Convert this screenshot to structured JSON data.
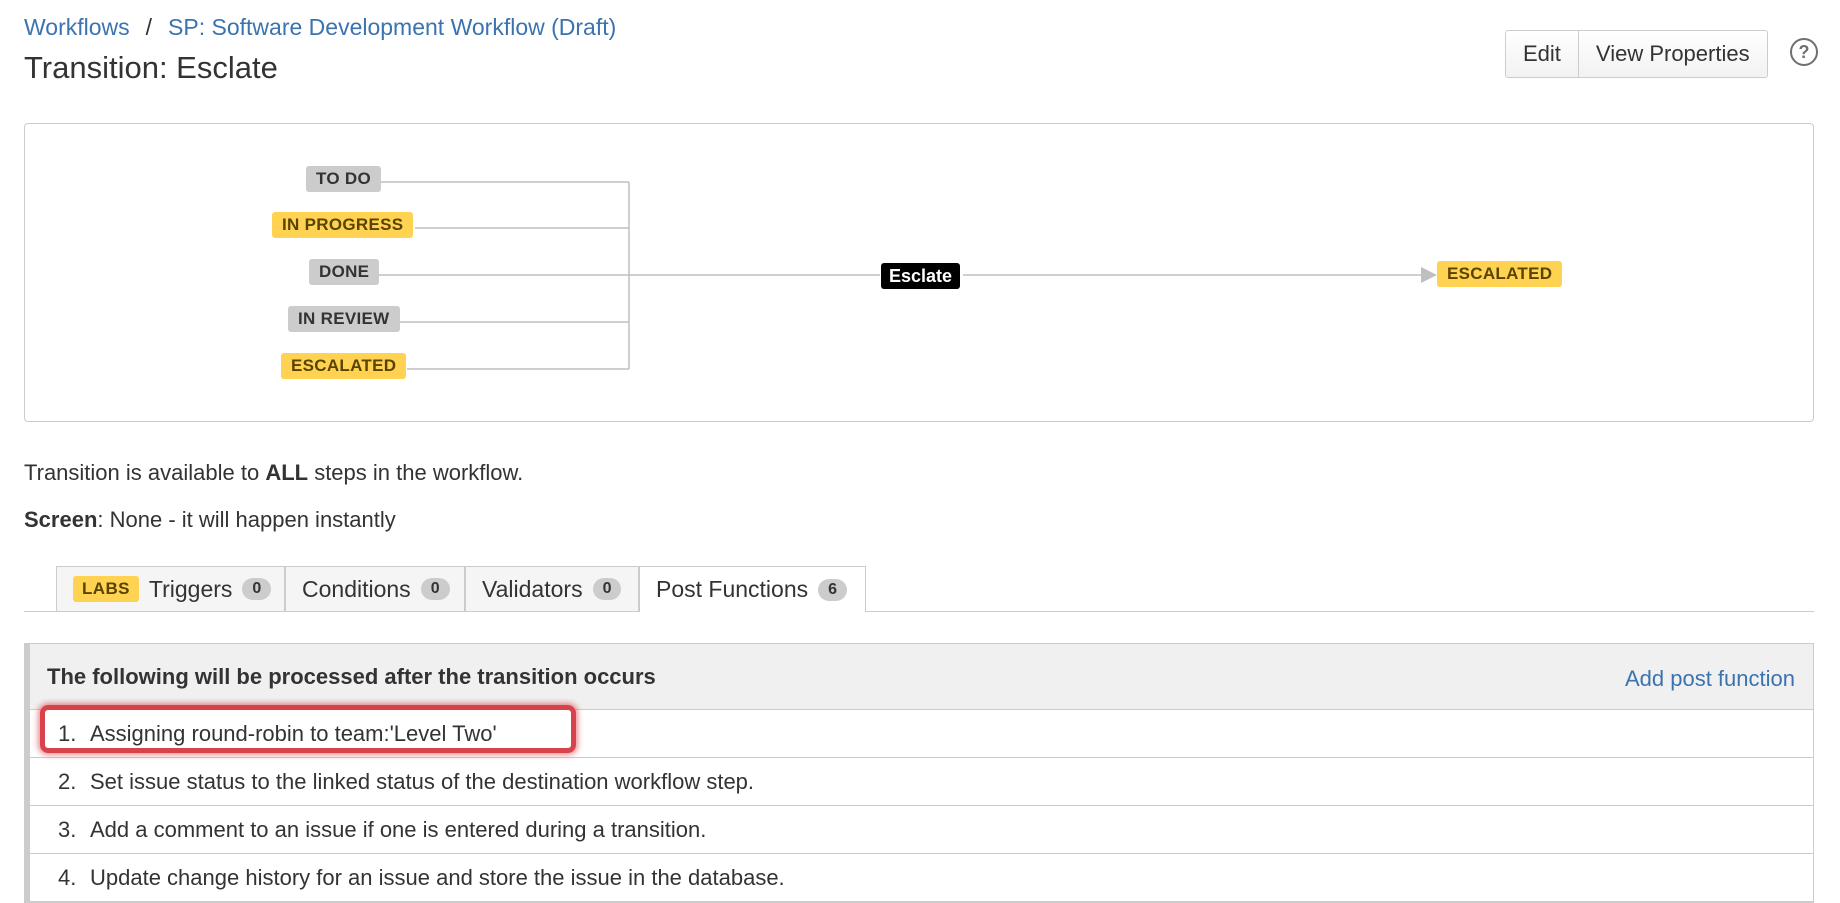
{
  "breadcrumb": {
    "workflows": "Workflows",
    "separator": "/",
    "workflow_name": "SP: Software Development Workflow (Draft)"
  },
  "page_title": "Transition: Esclate",
  "actions": {
    "edit": "Edit",
    "view_properties": "View Properties",
    "help": "?"
  },
  "diagram": {
    "sources": [
      {
        "label": "TO DO",
        "color": "grey"
      },
      {
        "label": "IN PROGRESS",
        "color": "yellow"
      },
      {
        "label": "DONE",
        "color": "grey"
      },
      {
        "label": "IN REVIEW",
        "color": "grey"
      },
      {
        "label": "ESCALATED",
        "color": "yellow"
      }
    ],
    "transition": "Esclate",
    "target": {
      "label": "ESCALATED",
      "color": "yellow"
    }
  },
  "availability": {
    "prefix": "Transition is available to ",
    "emphasis": "ALL",
    "suffix": " steps in the workflow."
  },
  "screen": {
    "label": "Screen",
    "value": ": None - it will happen instantly"
  },
  "tabs": {
    "labs": "LABS",
    "items": [
      {
        "label": "Triggers",
        "count": "0"
      },
      {
        "label": "Conditions",
        "count": "0"
      },
      {
        "label": "Validators",
        "count": "0"
      },
      {
        "label": "Post Functions",
        "count": "6"
      }
    ]
  },
  "post_functions": {
    "header": "The following will be processed after the transition occurs",
    "add_link": "Add post function",
    "items": [
      {
        "num": "1.",
        "text": "Assigning round-robin to team:'Level Two'"
      },
      {
        "num": "2.",
        "text": "Set issue status to the linked status of the destination workflow step."
      },
      {
        "num": "3.",
        "text": "Add a comment to an issue if one is entered during a transition."
      },
      {
        "num": "4.",
        "text": "Update change history for an issue and store the issue in the database."
      }
    ]
  },
  "colors": {
    "link": "#3b73af",
    "yellow_lozenge": "#ffd351",
    "grey_lozenge": "#cccccc",
    "highlight": "#d8434b"
  }
}
